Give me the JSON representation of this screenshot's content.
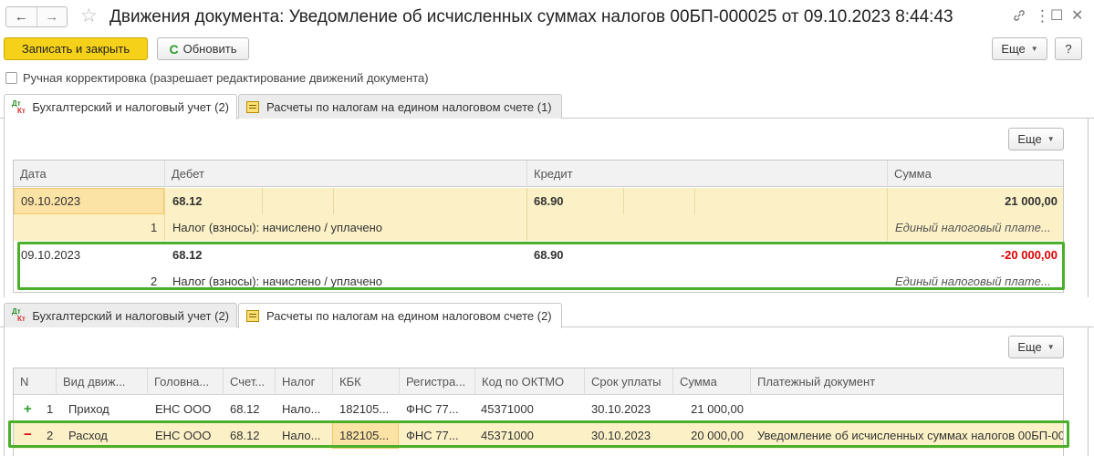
{
  "window": {
    "title": "Движения документа: Уведомление об исчисленных суммах налогов 00БП-000025 от 09.10.2023 8:44:43",
    "nav_back": "←",
    "nav_forward": "→",
    "star": "☆",
    "link_icon": "🔗",
    "menu_icon": "⋮",
    "max_icon": "☐",
    "close_icon": "✕"
  },
  "toolbar": {
    "save_close": "Записать и закрыть",
    "refresh": "Обновить",
    "refresh_icon": "C",
    "more": "Еще",
    "help": "?",
    "caret": "▼"
  },
  "manual_edit": {
    "label": "Ручная корректировка (разрешает редактирование движений документа)",
    "checked": false
  },
  "tabs": [
    {
      "label": "Бухгалтерский и налоговый учет (2)"
    },
    {
      "label": "Расчеты по налогам на едином налоговом счете (1)"
    }
  ],
  "tabs2": [
    {
      "label": "Бухгалтерский и налоговый учет (2)"
    },
    {
      "label": "Расчеты по налогам на едином налоговом счете (2)"
    }
  ],
  "dtkt": {
    "d": "Дт",
    "k": "Кт"
  },
  "panel1": {
    "more": "Еще",
    "columns": {
      "date": "Дата",
      "debit": "Дебет",
      "credit": "Кредит",
      "sum": "Сумма"
    },
    "rows": [
      {
        "date": "09.10.2023",
        "num": "1",
        "debit": "68.12",
        "credit": "68.90",
        "content": "Налог (взносы): начислено / уплачено",
        "sum": "21 000,00",
        "note": "Единый налоговый плате..."
      },
      {
        "date": "09.10.2023",
        "num": "2",
        "debit": "68.12",
        "credit": "68.90",
        "content": "Налог (взносы): начислено / уплачено",
        "sum": "-20 000,00",
        "note": "Единый налоговый плате..."
      }
    ]
  },
  "panel2": {
    "more": "Еще",
    "columns": {
      "n": "N",
      "kind": "Вид движ...",
      "head": "Головна...",
      "acct": "Счет...",
      "tax": "Налог",
      "kbk": "КБК",
      "reg": "Регистра...",
      "oktmo": "Код по ОКТМО",
      "due": "Срок уплаты",
      "sum": "Сумма",
      "doc": "Платежный документ"
    },
    "rows": [
      {
        "sign": "+",
        "n": "1",
        "kind": "Приход",
        "head": "ЕНС ООО",
        "acct": "68.12",
        "tax": "Нало...",
        "kbk": "182105...",
        "reg": "ФНС 77...",
        "oktmo": "45371000",
        "due": "30.10.2023",
        "sum": "21 000,00",
        "doc": ""
      },
      {
        "sign": "−",
        "n": "2",
        "kind": "Расход",
        "head": "ЕНС ООО",
        "acct": "68.12",
        "tax": "Нало...",
        "kbk": "182105...",
        "reg": "ФНС 77...",
        "oktmo": "45371000",
        "due": "30.10.2023",
        "sum": "20 000,00",
        "doc": "Уведомление об исчисленных суммах налогов 00БП-00"
      }
    ]
  },
  "colors": {
    "accent_yellow": "#f5d11a",
    "selected_row": "#fcf1c6",
    "highlight_green": "#4caf2a",
    "negative": "#e00000"
  }
}
